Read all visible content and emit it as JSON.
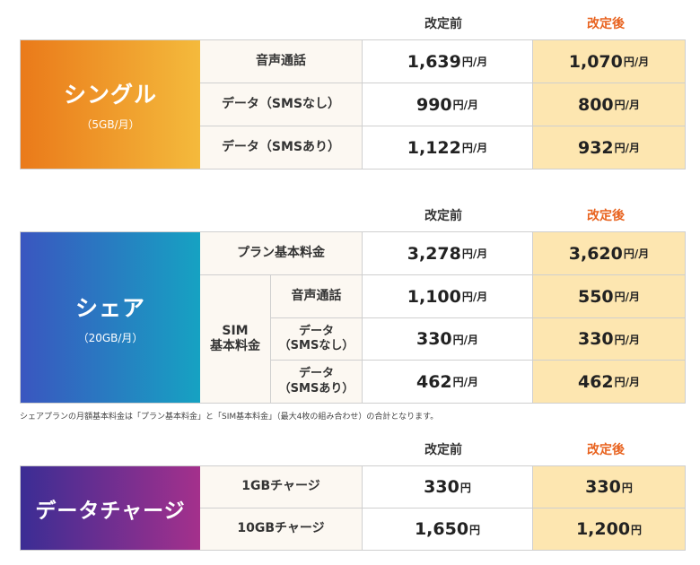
{
  "headers": {
    "before": "改定前",
    "after": "改定後"
  },
  "units": {
    "per_month": "円/月",
    "yen": "円"
  },
  "single": {
    "name": "シングル",
    "sub": "（5GB/月）",
    "rows": [
      {
        "label": "音声通話",
        "before": "1,639",
        "after": "1,070"
      },
      {
        "label": "データ（SMSなし）",
        "before": "990",
        "after": "800"
      },
      {
        "label": "データ（SMSあり）",
        "before": "1,122",
        "after": "932"
      }
    ]
  },
  "share": {
    "name": "シェア",
    "sub": "（20GB/月）",
    "plan_basic": {
      "label": "プラン基本料金",
      "before": "3,278",
      "after": "3,620"
    },
    "sim_label_line1": "SIM",
    "sim_label_line2": "基本料金",
    "sim_rows": [
      {
        "label_line1": "音声通話",
        "label_line2": "",
        "before": "1,100",
        "after": "550"
      },
      {
        "label_line1": "データ",
        "label_line2": "（SMSなし）",
        "before": "330",
        "after": "330"
      },
      {
        "label_line1": "データ",
        "label_line2": "（SMSあり）",
        "before": "462",
        "after": "462"
      }
    ],
    "note": "シェアプランの月額基本料金は「プラン基本料金」と「SIM基本料金」（最大4枚の組み合わせ）の合計となります。"
  },
  "charge": {
    "name": "データチャージ",
    "rows": [
      {
        "label": "1GBチャージ",
        "before": "330",
        "after": "330"
      },
      {
        "label": "10GBチャージ",
        "before": "1,650",
        "after": "1,200"
      }
    ]
  },
  "colors": {
    "accent_after": "#e8621e",
    "after_cell_bg": "#fde6b0",
    "single_gradient": [
      "#ea7a1a",
      "#f4ba3c"
    ],
    "share_gradient": [
      "#3a56c0",
      "#16a2c2"
    ],
    "charge_gradient": [
      "#3b2d94",
      "#a4308c"
    ]
  }
}
